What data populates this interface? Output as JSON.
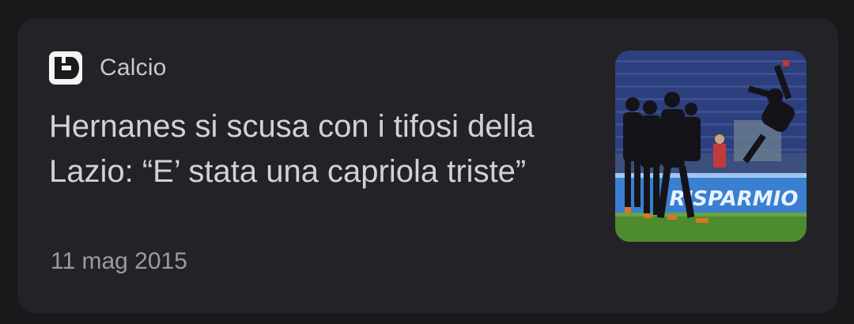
{
  "card": {
    "source": {
      "logo_icon": "fanpage-logo-icon",
      "name": "Calcio"
    },
    "headline": "Hernanes si scusa con i tifosi della Lazio: “E’ stata una capriola triste”",
    "date": "11 mag 2015",
    "thumbnail": {
      "description_icon": "football-match-photo",
      "banner_text": "RISPARMIO"
    }
  },
  "colors": {
    "background": "#19191c",
    "card": "#232327",
    "headline": "#d2d2d6",
    "source": "#c7c7cc",
    "date": "#9a9aa0"
  }
}
